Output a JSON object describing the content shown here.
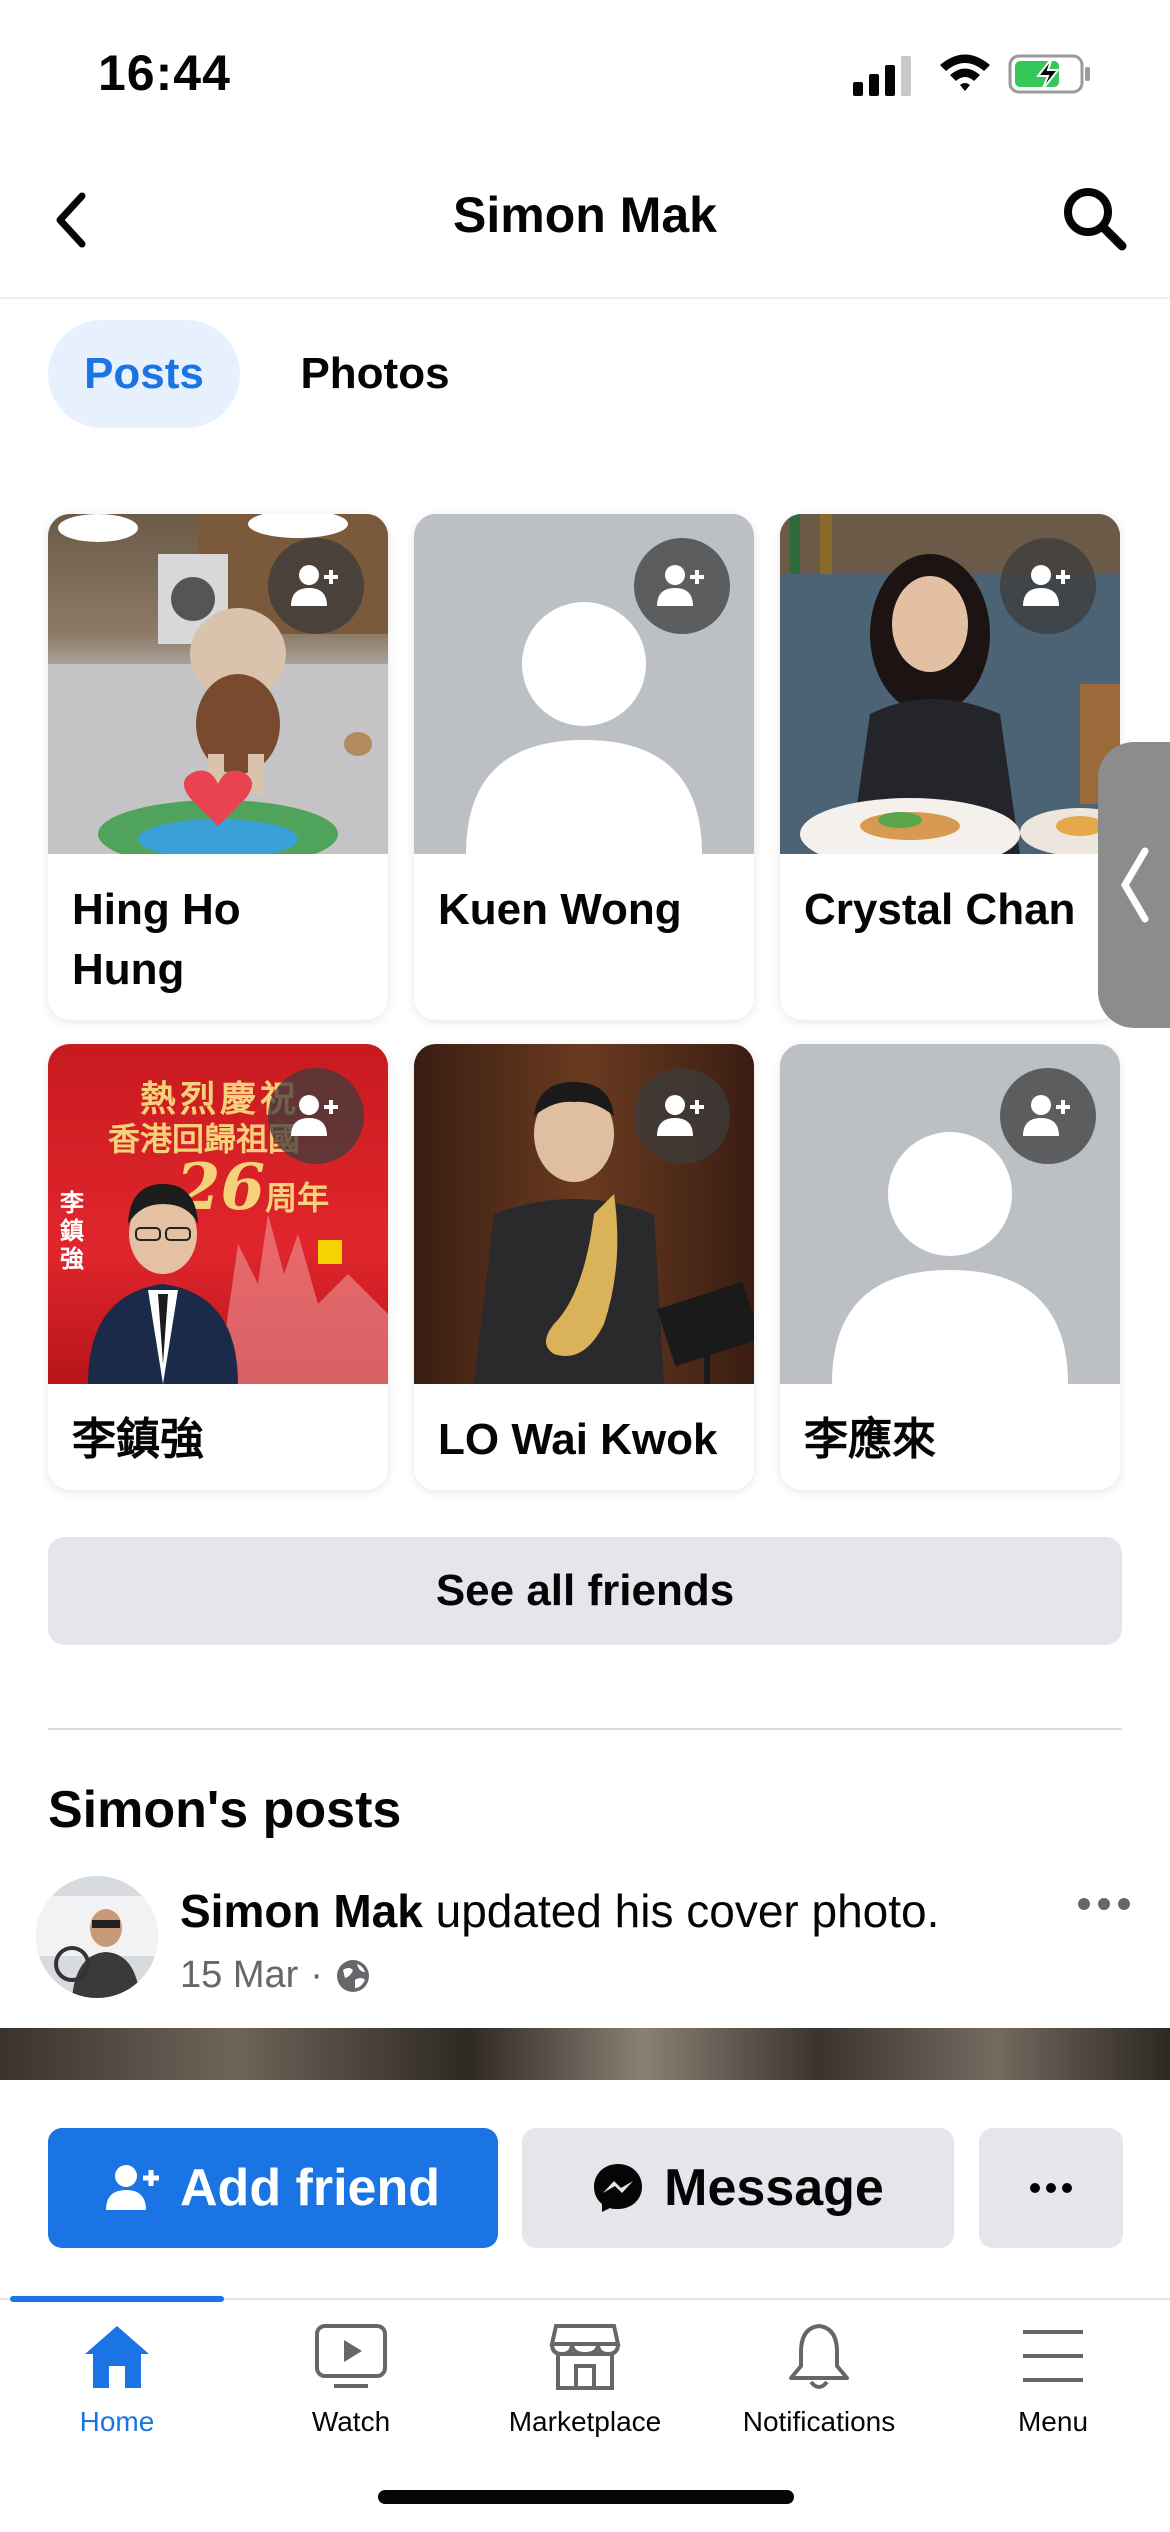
{
  "status_bar": {
    "time": "16:44"
  },
  "header": {
    "title": "Simon Mak"
  },
  "tabs": [
    {
      "label": "Posts",
      "active": true
    },
    {
      "label": "Photos",
      "active": false
    }
  ],
  "friends": [
    {
      "name": "Hing Ho Hung",
      "photo": "dog-photo"
    },
    {
      "name": "Kuen Wong",
      "photo": "placeholder"
    },
    {
      "name": "Crystal Chan",
      "photo": "woman-dining-photo"
    },
    {
      "name": "李鎮強",
      "photo": "poster-photo"
    },
    {
      "name": "LO Wai Kwok",
      "photo": "saxophone-photo"
    },
    {
      "name": "李應來",
      "photo": "placeholder"
    }
  ],
  "poster_text": {
    "line1": "熱烈慶祝",
    "line2": "香港回歸祖國",
    "number": "26",
    "suffix": "周年",
    "side": "李鎮強"
  },
  "see_all_label": "See all friends",
  "posts_heading": "Simon's posts",
  "post": {
    "author": "Simon Mak",
    "action": "updated his cover photo.",
    "date": "15 Mar"
  },
  "actions": {
    "add_friend": "Add friend",
    "message": "Message"
  },
  "nav": [
    {
      "label": "Home",
      "icon": "home-icon",
      "active": true
    },
    {
      "label": "Watch",
      "icon": "watch-icon",
      "active": false
    },
    {
      "label": "Marketplace",
      "icon": "marketplace-icon",
      "active": false
    },
    {
      "label": "Notifications",
      "icon": "bell-icon",
      "active": false
    },
    {
      "label": "Menu",
      "icon": "menu-icon",
      "active": false
    }
  ],
  "colors": {
    "accent": "#1b74e4",
    "tab_bg": "#e7f0fd",
    "button_grey": "#e4e6eb",
    "text_secondary": "#65676b"
  }
}
